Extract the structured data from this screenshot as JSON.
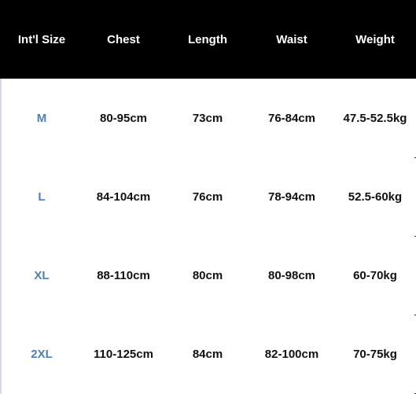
{
  "table": {
    "headers": [
      "Int'l Size",
      "Chest",
      "Length",
      "Waist",
      "Weight"
    ],
    "rows": [
      [
        "M",
        "80-95cm",
        "73cm",
        "76-84cm",
        "47.5-52.5kg"
      ],
      [
        "L",
        "84-104cm",
        "76cm",
        "78-94cm",
        "52.5-60kg"
      ],
      [
        "XL",
        "88-110cm",
        "80cm",
        "80-98cm",
        "60-70kg"
      ],
      [
        "2XL",
        "110-125cm",
        "84cm",
        "82-100cm",
        "70-75kg"
      ]
    ],
    "size_color": "#4f7fb8",
    "header_background": "#000000"
  }
}
